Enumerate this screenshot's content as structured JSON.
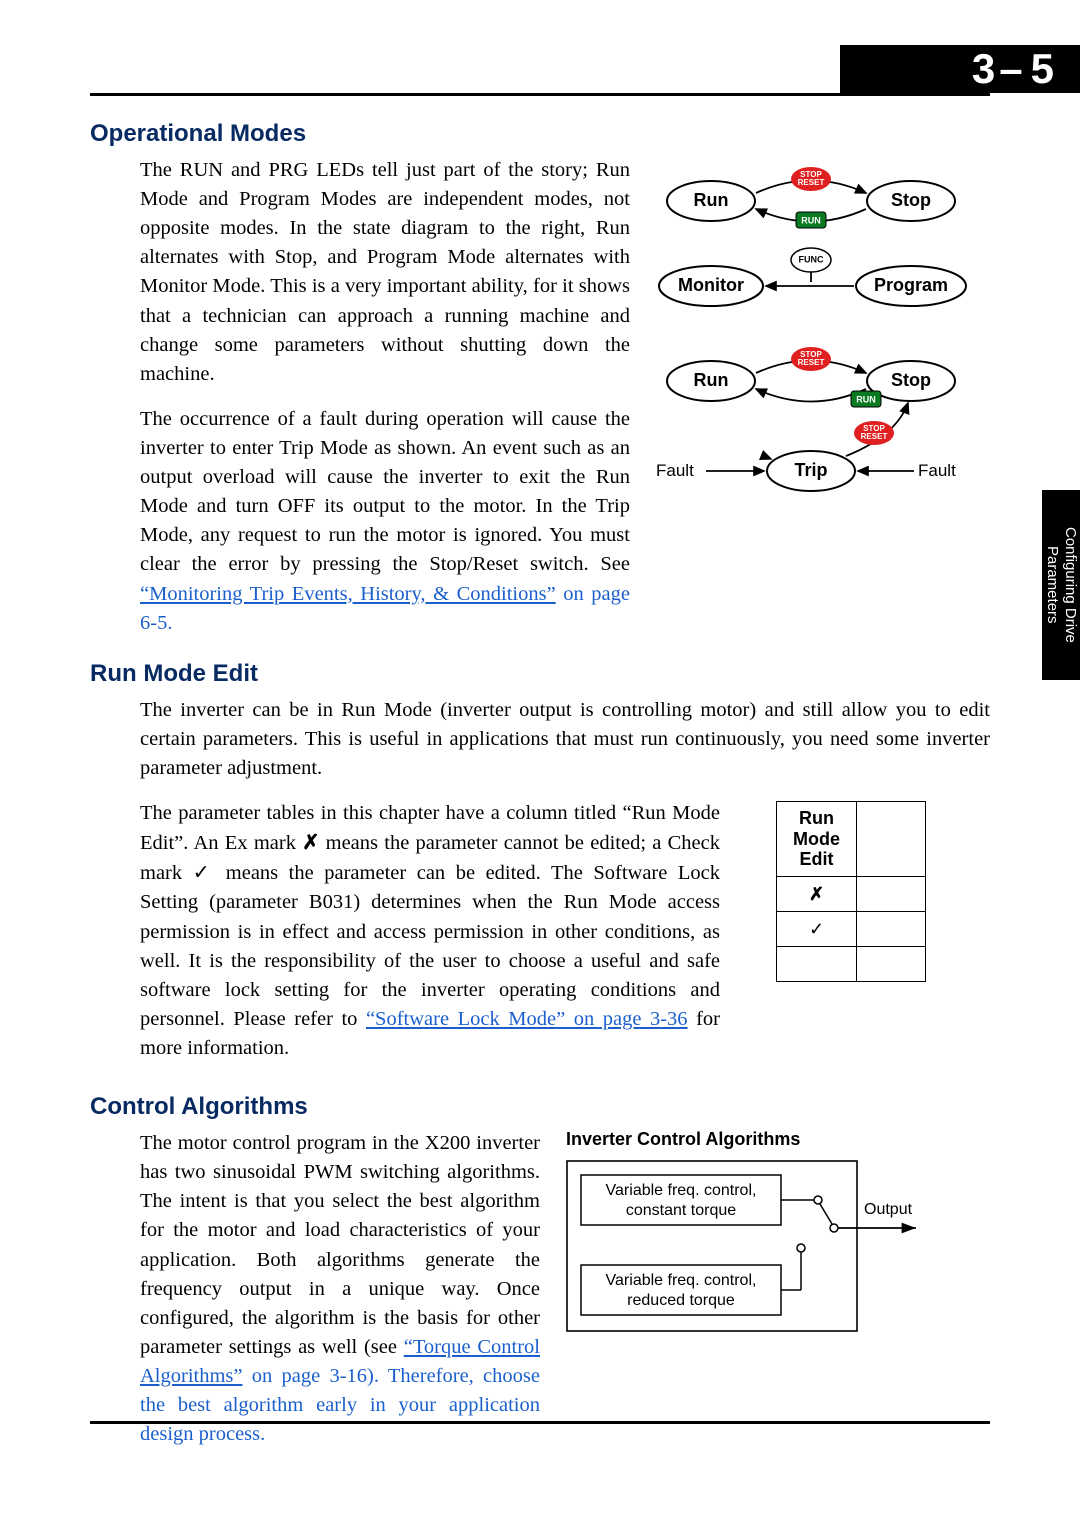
{
  "page_number": {
    "chapter": "3",
    "sep": "–",
    "page": "5"
  },
  "side_tab": "Configuring Drive\nParameters",
  "sec1": {
    "title": "Operational Modes",
    "p1": "The RUN and PRG LEDs tell just part of the story; Run Mode and Program Modes are independent modes, not opposite modes. In the state diagram to the right, Run alternates with Stop, and Program Mode alternates with Monitor Mode. This is a very important ability, for it shows that a technician can approach a running machine and change some parameters without shutting down the machine.",
    "p2_a": "The occurrence of a fault during operation will cause the inverter to enter Trip Mode as shown. An event such as an output overload will cause the inverter to exit the Run Mode and turn OFF its output to the motor. In the Trip Mode, any request to run the motor is ignored. You must clear the error by pressing the Stop/Reset switch. See ",
    "p2_link": "“Monitoring Trip Events, History, & Conditions”",
    "p2_b": " on page 6-5.",
    "diagram1": {
      "states": [
        "Run",
        "Stop",
        "Monitor",
        "Program"
      ],
      "btn_stop": "STOP\nRESET",
      "btn_run": "RUN",
      "btn_func": "FUNC"
    },
    "diagram2": {
      "states": [
        "Run",
        "Stop",
        "Trip"
      ],
      "fault_label": "Fault",
      "btn_stop": "STOP\nRESET",
      "btn_run": "RUN"
    }
  },
  "sec2": {
    "title": "Run Mode Edit",
    "p1": "The inverter can be in Run Mode (inverter output is controlling motor) and still allow you to edit certain parameters. This is useful in applications that must run continuously, you need some inverter parameter adjustment.",
    "p2_a": "The parameter tables in this chapter have a column titled “Run Mode Edit”. An Ex mark ",
    "p2_x": "✗",
    "p2_b": " means the parameter cannot be edited; a Check mark ",
    "p2_chk": "✓",
    "p2_c": " means the parameter can be edited. The Software Lock Setting (parameter B031) determines when the Run Mode access permission is in effect and access permission in other conditions, as well. It is the responsibility of the user to choose a useful and safe software lock setting for the inverter operating conditions and personnel. Please refer to ",
    "p2_link": "“Software Lock Mode” on page 3-36",
    "p2_d": " for more information.",
    "table": {
      "header": "Run\nMode\nEdit",
      "rows": [
        "✗",
        "✓"
      ]
    }
  },
  "sec3": {
    "title": "Control Algorithms",
    "p1_a": "The motor control program in the X200 inverter has two sinusoidal PWM switching algorithms. The intent is that you select the best algorithm for the motor and load characteristics of your application. Both algorithms generate the frequency output in a unique way. Once configured, the algorithm is the basis for other parameter settings as well (see ",
    "p1_link": "“Torque Control Algorithms”",
    "p1_b": " on page 3-16). Therefore, choose the best algorithm early in your application design process.",
    "figure": {
      "title": "Inverter Control Algorithms",
      "box1_l1": "Variable freq. control,",
      "box1_l2": "constant torque",
      "box2_l1": "Variable freq. control,",
      "box2_l2": "reduced torque",
      "output": "Output"
    }
  }
}
